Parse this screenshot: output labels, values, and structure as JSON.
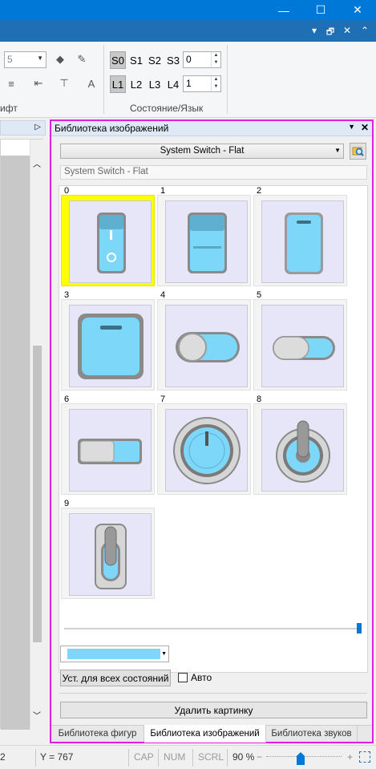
{
  "window": {
    "minimize_glyph": "—",
    "maximize_glyph": "☐",
    "close_glyph": "✕"
  },
  "menubar": {
    "dropdown_glyph": "▾",
    "restore_glyph": "🗗",
    "close_glyph": "✕",
    "pin_glyph": "⌃"
  },
  "ribbon": {
    "font_size_value": "5",
    "states": [
      "S0",
      "S1",
      "S2",
      "S3"
    ],
    "state_value": "0",
    "langs": [
      "L1",
      "L2",
      "L3",
      "L4"
    ],
    "lang_value": "1",
    "font_group_label": "ифт",
    "state_group_label": "Состояние/Язык",
    "selected_state": "S0",
    "selected_lang": "L1"
  },
  "library": {
    "title": "Библиотека изображений",
    "dropdown_glyph": "▼",
    "close_glyph": "✕",
    "set_selected": "System Switch - Flat",
    "set_name_field": "System Switch - Flat",
    "items": [
      {
        "index": "0",
        "kind": "rocker-dot",
        "selected": true
      },
      {
        "index": "1",
        "kind": "rocker-line"
      },
      {
        "index": "2",
        "kind": "rocker-tall"
      },
      {
        "index": "3",
        "kind": "square-button"
      },
      {
        "index": "4",
        "kind": "toggle-off"
      },
      {
        "index": "5",
        "kind": "toggle-small"
      },
      {
        "index": "6",
        "kind": "slide-switch"
      },
      {
        "index": "7",
        "kind": "rotary-knob"
      },
      {
        "index": "8",
        "kind": "toggle-lever-round"
      },
      {
        "index": "9",
        "kind": "toggle-lever-rect"
      }
    ],
    "color_value": "#7dd7f8",
    "set_all_states_button": "Уст. для всех состояний",
    "auto_label": "Авто",
    "delete_button": "Удалить картинку"
  },
  "tabs": [
    "Библиотека фигур",
    "Библиотека изображений",
    "Библиотека звуков"
  ],
  "active_tab": "Библиотека изображений",
  "statusbar": {
    "x_tail": "2",
    "y_readout": "Y = 767",
    "cap": "CAP",
    "num": "NUM",
    "scrl": "SCRL",
    "zoom": "90 %",
    "zoom_minus": "−",
    "zoom_plus": "+"
  },
  "colors": {
    "accent": "#0078d7",
    "highlight": "#ff00ff",
    "selection": "#ffff00",
    "switch_blue": "#7dd7f8"
  }
}
